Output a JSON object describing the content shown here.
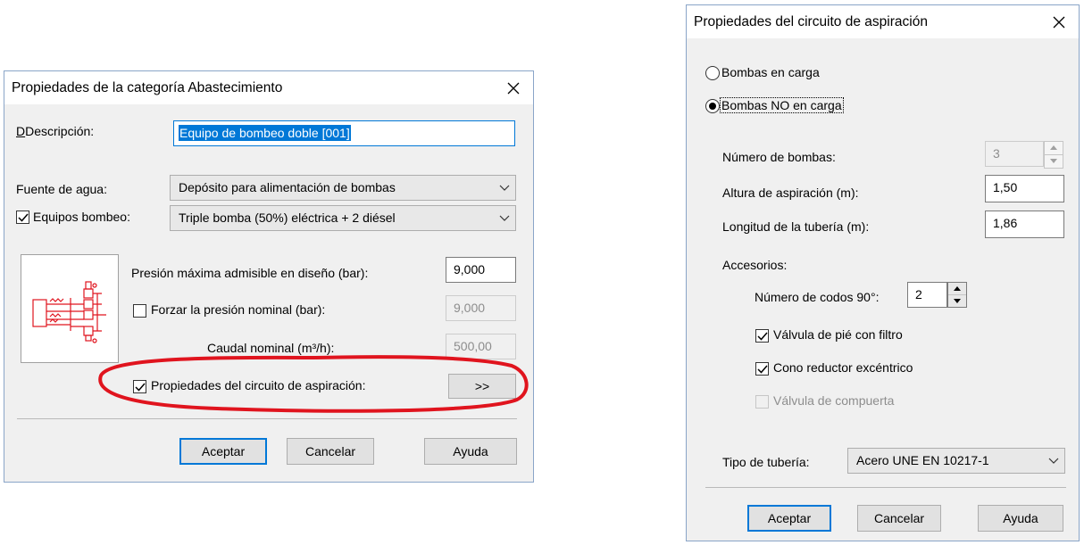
{
  "dialog1": {
    "title": "Propiedades de la categoría Abastecimiento",
    "descripcion_label": "Descripción:",
    "descripcion_value": "Equipo de bombeo doble [001]",
    "fuente_label": "Fuente de agua:",
    "fuente_value": "Depósito para alimentación de bombas",
    "equipos_label": "Equipos bombeo:",
    "equipos_checked": true,
    "equipos_value": "Triple bomba (50%) eléctrica + 2 diésel",
    "presion_max_label": "Presión máxima admisible en diseño (bar):",
    "presion_max_value": "9,000",
    "forzar_label": "Forzar la presión nominal (bar):",
    "forzar_checked": false,
    "forzar_value": "9,000",
    "caudal_label": "Caudal nominal (m³/h):",
    "caudal_value": "500,00",
    "aspiracion_label": "Propiedades del circuito de aspiración:",
    "aspiracion_checked": true,
    "aspiracion_button": ">>",
    "annotation_color": "#e0141e",
    "buttons": {
      "aceptar": "Aceptar",
      "cancelar": "Cancelar",
      "ayuda": "Ayuda"
    }
  },
  "dialog2": {
    "title": "Propiedades del circuito de aspiración",
    "radio_carga": "Bombas en carga",
    "radio_no_carga": "Bombas NO en carga",
    "selected_radio": "no_carga",
    "num_bombas_label": "Número de bombas:",
    "num_bombas_value": "3",
    "altura_label": "Altura de aspiración (m):",
    "altura_value": "1,50",
    "longitud_label": "Longitud de la tubería (m):",
    "longitud_value": "1,86",
    "accesorios_label": "Accesorios:",
    "codos_label": "Número de codos 90°:",
    "codos_value": "2",
    "valvula_pie_label": "Válvula de pié con filtro",
    "valvula_pie_checked": true,
    "cono_label": "Cono reductor excéntrico",
    "cono_checked": true,
    "valvula_compuerta_label": "Válvula de compuerta",
    "valvula_compuerta_checked": false,
    "tipo_label": "Tipo de tubería:",
    "tipo_value": "Acero UNE EN 10217-1",
    "buttons": {
      "aceptar": "Aceptar",
      "cancelar": "Cancelar",
      "ayuda": "Ayuda"
    }
  },
  "colors": {
    "accent": "#0078d7",
    "selection": "#0078d7",
    "schematic": "#e0141e"
  }
}
